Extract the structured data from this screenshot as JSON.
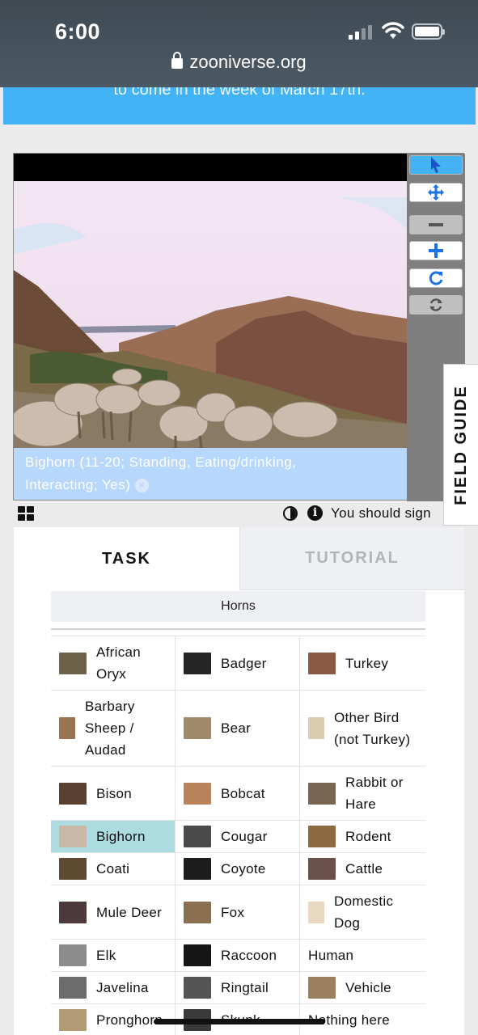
{
  "status_bar": {
    "time": "6:00"
  },
  "browser": {
    "url": "zooniverse.org"
  },
  "banner": {
    "text": "to come in the week of March 17th."
  },
  "viewer": {
    "annotation_line1": "Bighorn (11-20; Standing, Eating/drinking,",
    "annotation_line2": "Interacting; Yes)",
    "remove_symbol": "×",
    "tools": [
      "pointer-icon",
      "move-icon",
      "zoom-out-icon",
      "zoom-in-icon",
      "rotate-icon",
      "reset-icon"
    ]
  },
  "field_guide": {
    "label": "FIELD GUIDE"
  },
  "meta": {
    "signin_text": "You should sign",
    "info_symbol": "i"
  },
  "tabs": {
    "task": "TASK",
    "tutorial": "TUTORIAL"
  },
  "filter": {
    "label": "Horns"
  },
  "colors": {
    "selected": "#acdce0",
    "banner": "#43b3f6",
    "annotation": "#b7d7fd",
    "accent": "#1a73e8"
  },
  "choices": [
    [
      {
        "label_lines": [
          "African",
          "Oryx"
        ],
        "thumb": "#6d6248"
      },
      {
        "label_lines": [
          "Badger"
        ],
        "thumb": "#262626"
      },
      {
        "label_lines": [
          "Turkey"
        ],
        "thumb": "#8a5a45"
      }
    ],
    [
      {
        "label_lines": [
          "Barbary",
          "Sheep /",
          "Audad"
        ],
        "thumb": "#9a7450",
        "small": true
      },
      {
        "label_lines": [
          "Bear"
        ],
        "thumb": "#a08a6c"
      },
      {
        "label_lines": [
          "Other Bird",
          "(not Turkey)"
        ],
        "thumb": "#d9ccb0",
        "small": true
      }
    ],
    [
      {
        "label_lines": [
          "Bison"
        ],
        "thumb": "#5a4030"
      },
      {
        "label_lines": [
          "Bobcat"
        ],
        "thumb": "#b8835a"
      },
      {
        "label_lines": [
          "Rabbit or",
          "Hare"
        ],
        "thumb": "#7a6650"
      }
    ],
    [
      {
        "label_lines": [
          "Bighorn"
        ],
        "thumb": "#c9b8a6",
        "selected": true
      },
      {
        "label_lines": [
          "Cougar"
        ],
        "thumb": "#4a4a4a"
      },
      {
        "label_lines": [
          "Rodent"
        ],
        "thumb": "#8a6a3e"
      }
    ],
    [
      {
        "label_lines": [
          "Coati"
        ],
        "thumb": "#5d4a30"
      },
      {
        "label_lines": [
          "Coyote"
        ],
        "thumb": "#1d1d1d"
      },
      {
        "label_lines": [
          "Cattle"
        ],
        "thumb": "#6a5048"
      }
    ],
    [
      {
        "label_lines": [
          "Mule Deer"
        ],
        "thumb": "#4c3a3c"
      },
      {
        "label_lines": [
          "Fox"
        ],
        "thumb": "#8a7050"
      },
      {
        "label_lines": [
          "Domestic",
          "Dog"
        ],
        "thumb": "#e8d8c0",
        "small": true
      }
    ],
    [
      {
        "label_lines": [
          "Elk"
        ],
        "thumb": "#8c8c8c"
      },
      {
        "label_lines": [
          "Raccoon"
        ],
        "thumb": "#161616"
      },
      {
        "label_lines": [
          "Human"
        ],
        "thumb": ""
      }
    ],
    [
      {
        "label_lines": [
          "Javelina"
        ],
        "thumb": "#6c6c6c"
      },
      {
        "label_lines": [
          "Ringtail"
        ],
        "thumb": "#555555"
      },
      {
        "label_lines": [
          "Vehicle"
        ],
        "thumb": "#9a8060"
      }
    ],
    [
      {
        "label_lines": [
          "Pronghorn"
        ],
        "thumb": "#b29a74"
      },
      {
        "label_lines": [
          "Skunk"
        ],
        "thumb": "#3a3a3a"
      },
      {
        "label_lines": [
          "Nothing here"
        ],
        "thumb": ""
      }
    ]
  ]
}
